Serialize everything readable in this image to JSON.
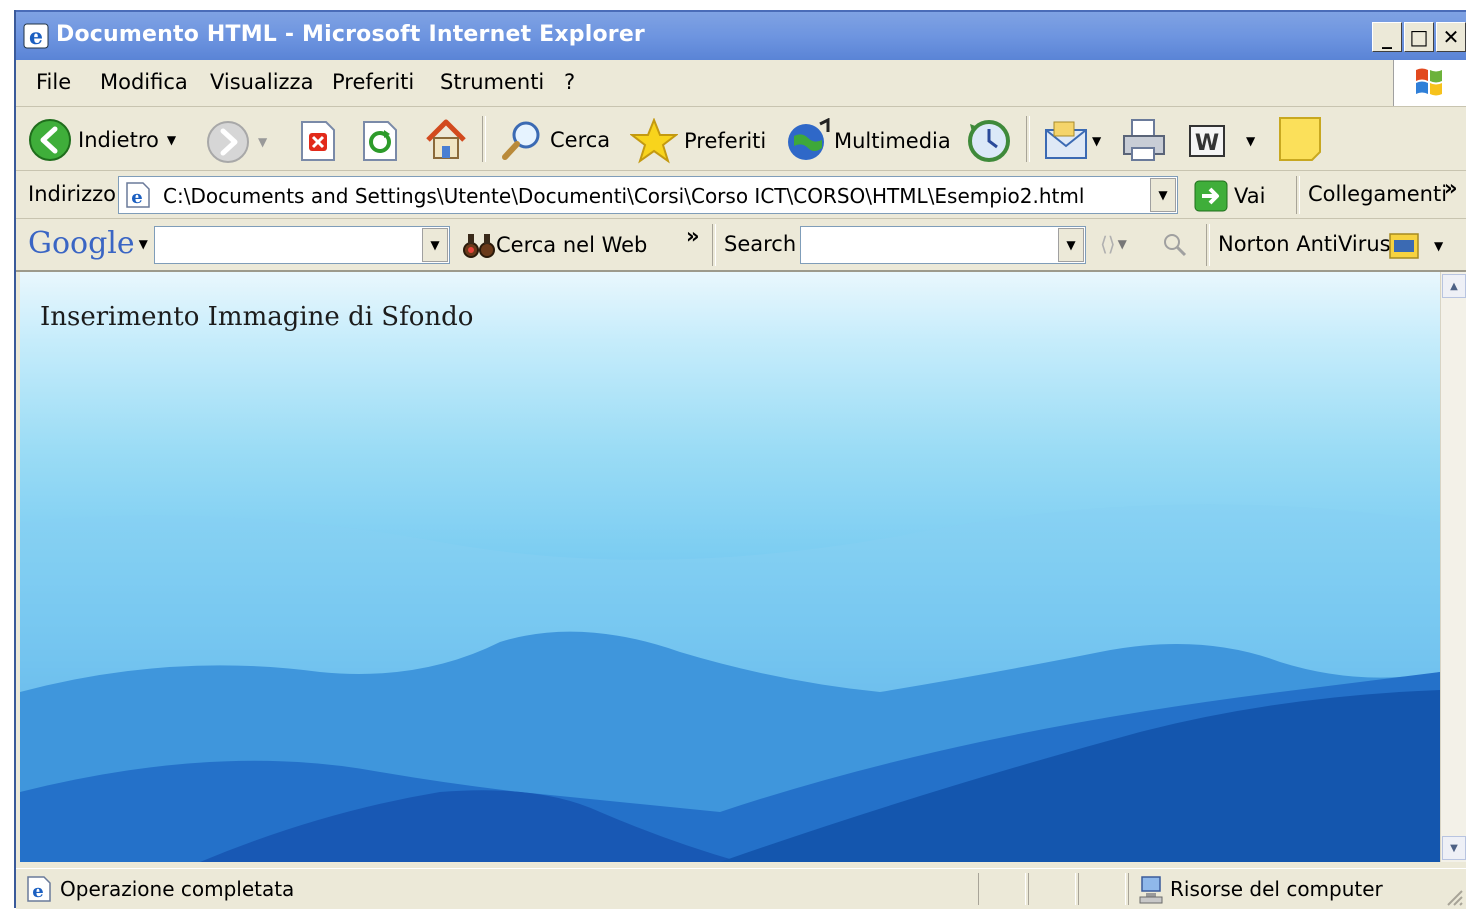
{
  "window": {
    "title": "Documento HTML - Microsoft Internet Explorer"
  },
  "menu": [
    "File",
    "Modifica",
    "Visualizza",
    "Preferiti",
    "Strumenti",
    "?"
  ],
  "toolbar": {
    "back_label": "Indietro",
    "search_label": "Cerca",
    "favorites_label": "Preferiti",
    "media_label": "Multimedia"
  },
  "address": {
    "label": "Indirizzo",
    "value": "C:\\Documents and Settings\\Utente\\Documenti\\Corsi\\Corso ICT\\CORSO\\HTML\\Esempio2.html",
    "go_label": "Vai",
    "links_label": "Collegamenti",
    "more": "»"
  },
  "googlebar": {
    "logo": "Google",
    "search_web_label": "Cerca nel Web",
    "more": "»",
    "search_label": "Search",
    "norton_label": "Norton AntiVirus"
  },
  "page": {
    "text": "Inserimento Immagine di Sfondo"
  },
  "status": {
    "text": "Operazione completata",
    "zone": "Risorse del computer"
  },
  "colors": {
    "titlebar": "#6e95e0",
    "chrome": "#ece9d8",
    "sky": "#9bdcf5",
    "mountains": "#1866c4"
  }
}
